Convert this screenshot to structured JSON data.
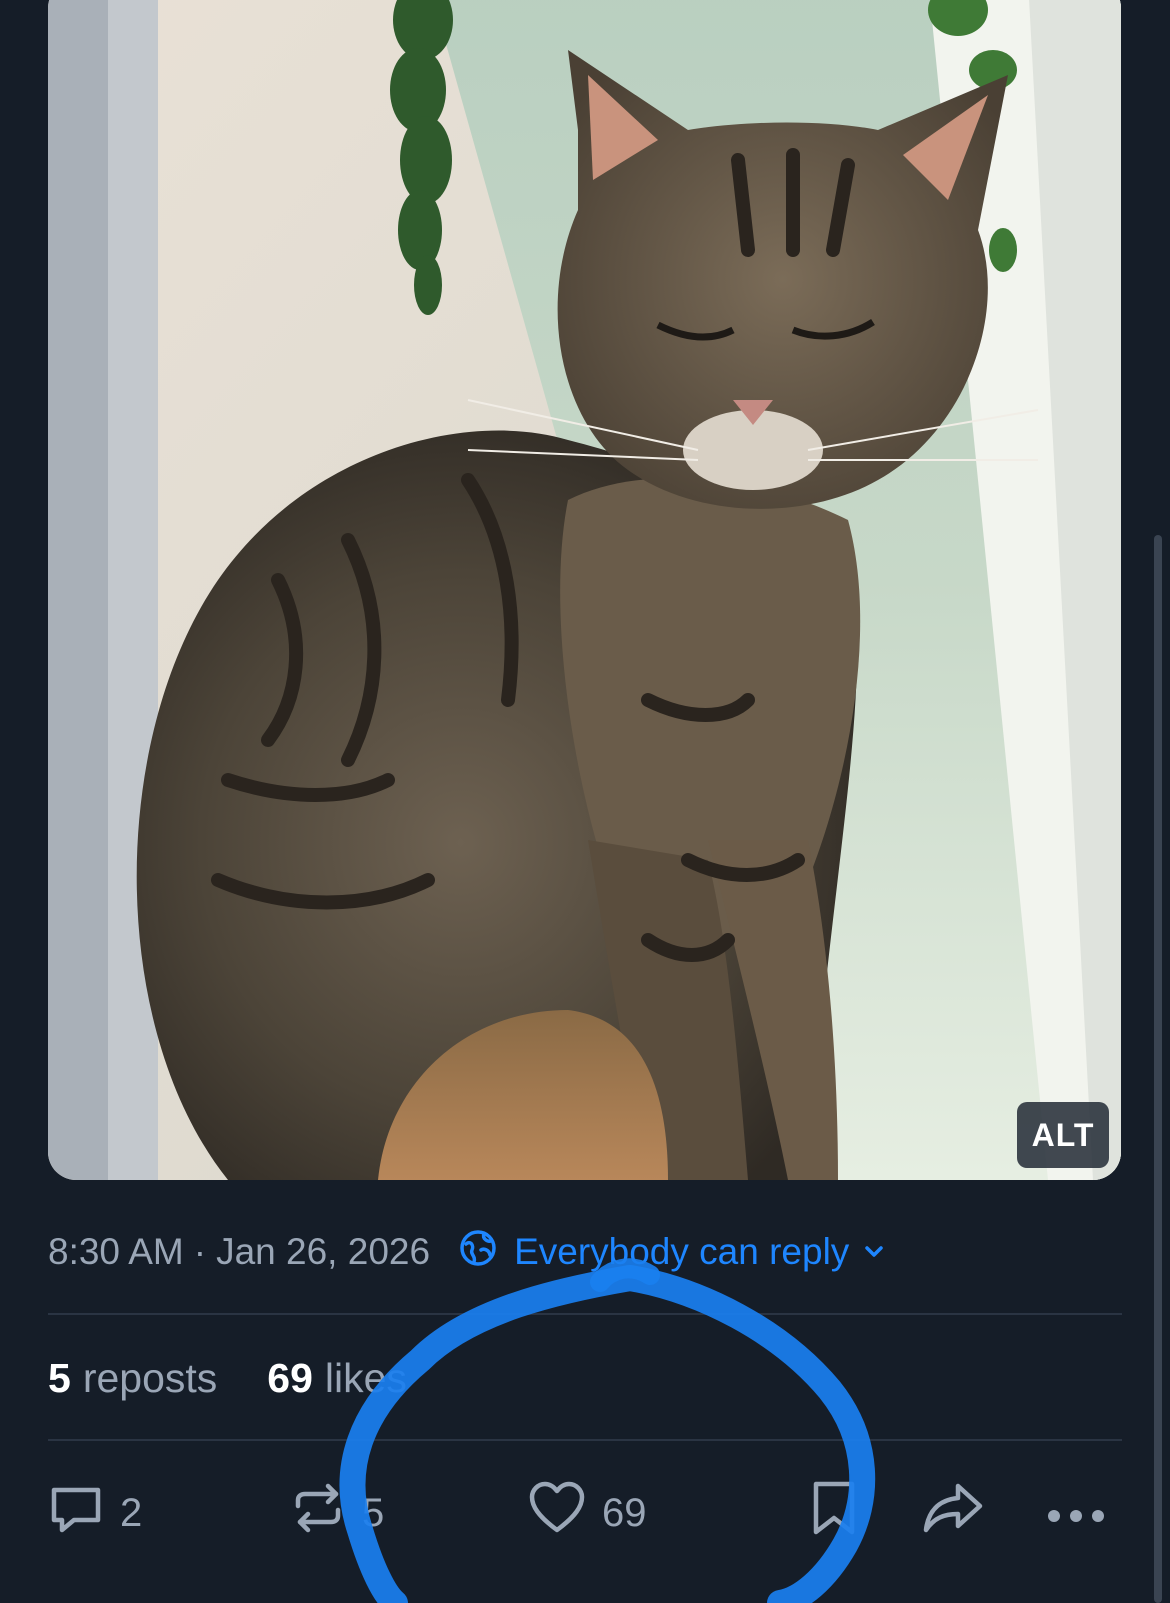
{
  "post": {
    "image": {
      "alt_badge": "ALT",
      "subject": "tabby cat photo"
    },
    "timestamp": "8:30 AM",
    "separator": "·",
    "date": "Jan 26, 2026",
    "reply_setting": "Everybody can reply",
    "counts": {
      "reposts_num": "5",
      "reposts_label": "reposts",
      "likes_num": "69",
      "likes_label": "likes"
    },
    "actions": {
      "replies": "2",
      "reposts": "5",
      "likes": "69"
    }
  },
  "colors": {
    "background": "#151d28",
    "accent": "#1e86ff",
    "muted_text": "#9aa6b6",
    "annotation": "#1a7ff0"
  }
}
